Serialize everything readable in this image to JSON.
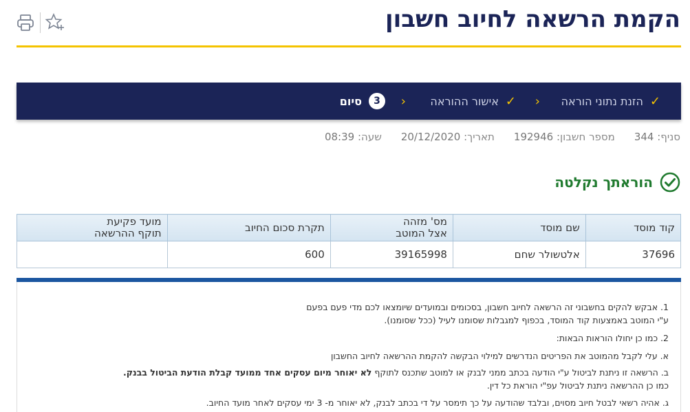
{
  "header": {
    "title": "הקמת הרשאה לחיוב חשבון"
  },
  "toolbar": {
    "print_icon": "printer-icon",
    "favorite_icon": "star-plus-icon"
  },
  "stepper": {
    "steps": [
      {
        "label": "הזנת נתוני הוראה",
        "status": "done"
      },
      {
        "label": "אישור ההוראה",
        "status": "done"
      },
      {
        "label": "סיום",
        "number": "3",
        "status": "current"
      }
    ]
  },
  "info": {
    "branch_label": "סניף:",
    "branch_value": "344",
    "account_label": "מספר חשבון:",
    "account_value": "192946",
    "date_label": "תאריך:",
    "date_value": "20/12/2020",
    "time_label": "שעה:",
    "time_value": "08:39"
  },
  "success": {
    "message": "הוראתך נקלטה"
  },
  "table": {
    "headers": [
      "קוד מוסד",
      "שם מוסד",
      "מס' מזהה\nאצל המוטב",
      "תקרת סכום החיוב",
      "מועד פקיעת\nתוקף ההרשאה"
    ],
    "rows": [
      [
        "37696",
        "אלטשולר שחם",
        "39165998",
        "600",
        ""
      ]
    ]
  },
  "terms": {
    "p1a": "1. אבקש להקים בחשבוני זה הרשאה לחיוב חשבון, בסכומים ובמועדים שיומצאו לכם מדי פעם בפעם",
    "p1b": "ע\"י המוטב באמצעות קוד המוסד, בכפוף למגבלות שסומנו לעיל (ככל שסומנו).",
    "p2": "2. כמו כן יחולו הוראות הבאות:",
    "p3": "א. עלי לקבל מהמוטב את הפריטים הנדרשים למילוי הבקשה להקמת ההרשאה לחיוב החשבון",
    "p4a_pre": "ב. הרשאה זו ניתנת לביטול ע\"י הודעה בכתב ממני לבנק או למוטב שתכנס לתוקף ",
    "p4a_bold": "לא יאוחר מיום עסקים אחד ממועד קבלת הודעת הביטול בבנק.",
    "p4b": "כמו כן ההרשאה ניתנת לביטול עפ\"י הוראת כל דין.",
    "p5": "ג. אהיה רשאי לבטל חיוב מסוים, ובלבד שהודעה על כך תימסר על די בכתב לבנק, לא יאוחר מ- 3 ימי עסקים לאחר מועד החיוב."
  }
}
